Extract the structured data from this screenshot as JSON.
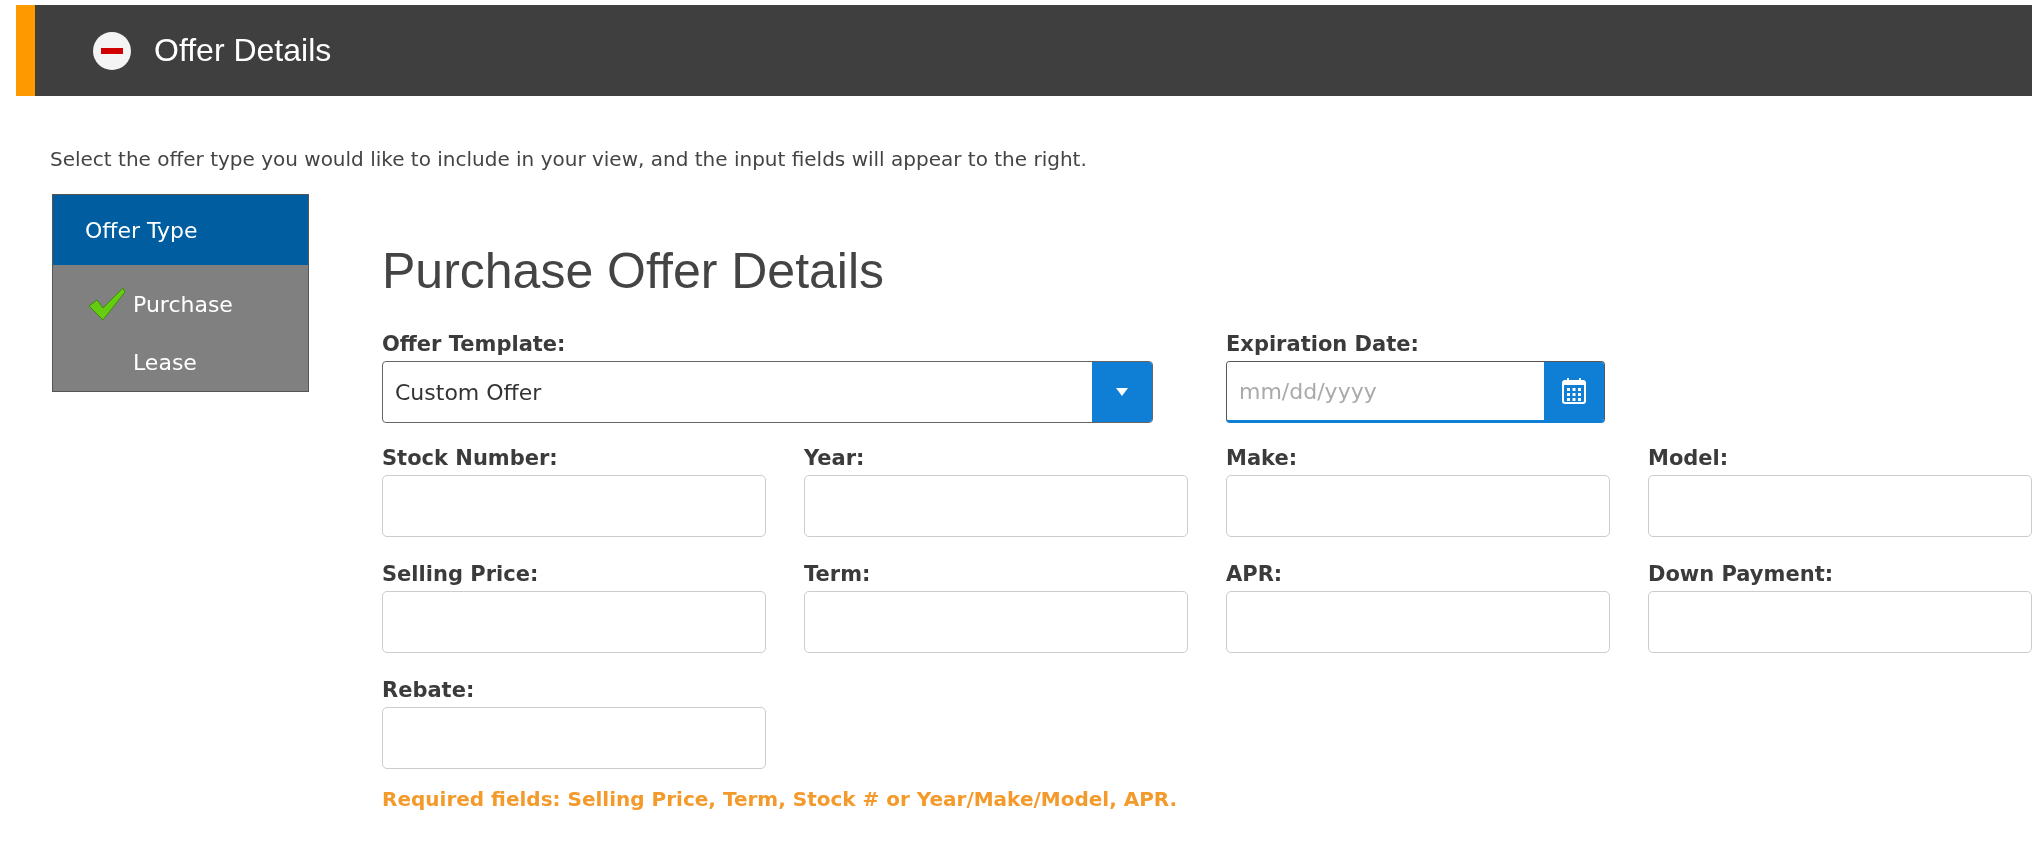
{
  "panel": {
    "title": "Offer Details",
    "expanded": true
  },
  "intro": "Select the offer type you would like to include in your view, and the input fields will appear to the right.",
  "offer_type": {
    "title": "Offer Type",
    "options": [
      {
        "label": "Purchase",
        "selected": true
      },
      {
        "label": "Lease",
        "selected": false
      }
    ]
  },
  "heading": "Purchase Offer Details",
  "offer_template": {
    "label": "Offer Template:",
    "value": "Custom Offer"
  },
  "expiration_date": {
    "label": "Expiration Date:",
    "placeholder": "mm/dd/yyyy"
  },
  "fields": [
    {
      "label": "Stock Number:"
    },
    {
      "label": "Year:"
    },
    {
      "label": "Make:"
    },
    {
      "label": "Model:"
    },
    {
      "label": "Selling Price:"
    },
    {
      "label": "Term:"
    },
    {
      "label": "APR:"
    },
    {
      "label": "Down Payment:"
    },
    {
      "label": "Rebate:"
    }
  ],
  "required_note": "Required fields: Selling Price, Term, Stock # or Year/Make/Model, APR."
}
